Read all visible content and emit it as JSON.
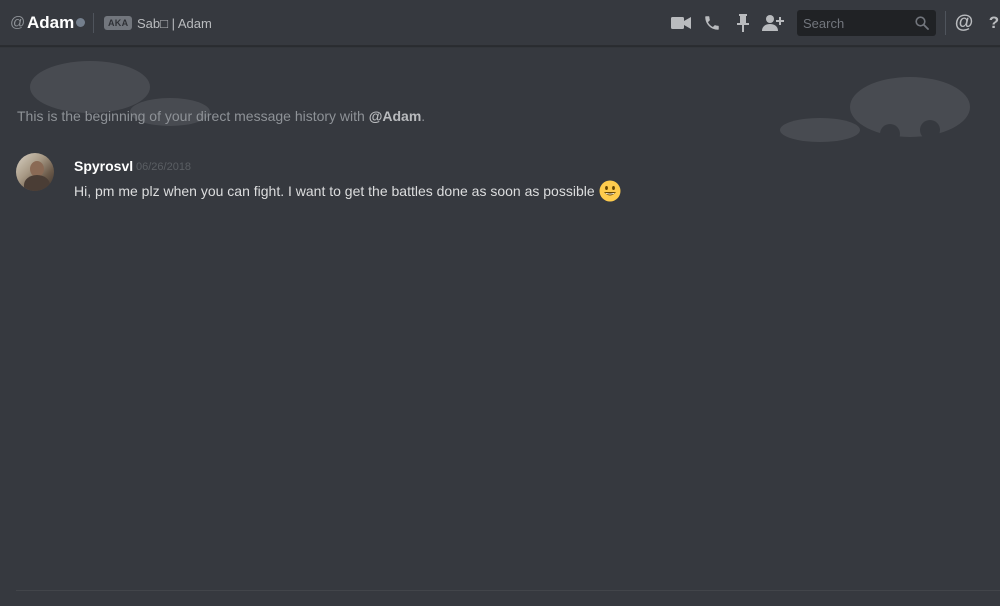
{
  "header": {
    "at_symbol": "@",
    "channel_name": "Adam",
    "status": "offline",
    "status_color": "#747f8d",
    "aka_label": "AKA",
    "aka_names": "Sab□ | Adam",
    "icons": [
      "video-call-icon",
      "voice-call-icon",
      "pin-icon",
      "add-friend-icon",
      "mention-icon",
      "help-icon"
    ],
    "search_placeholder": "Search",
    "mention_symbol": "@",
    "help_symbol": "?"
  },
  "history": {
    "intro_prefix": "This is the beginning of your direct message history with ",
    "intro_mention": "@Adam",
    "intro_suffix": "."
  },
  "messages": [
    {
      "author": "Spyrosvl",
      "timestamp": "06/26/2018",
      "text": "Hi, pm me plz when you can fight. I want to get the battles done as soon as possible",
      "emoji": "smiley-emoji"
    }
  ],
  "colors": {
    "background": "#36393f",
    "header_text": "#ffffff",
    "muted_text": "#8e9297",
    "message_text": "#dcddde",
    "search_bg": "#202225",
    "emoji_yellow": "#ffcc4d"
  }
}
